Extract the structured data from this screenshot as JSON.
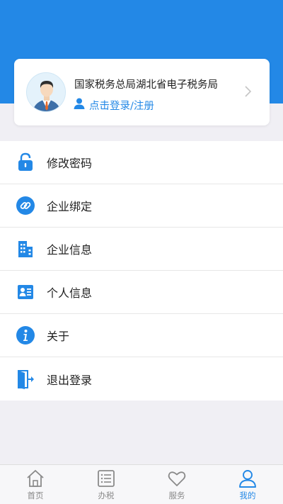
{
  "profile": {
    "org_name": "国家税务总局湖北省电子税务局",
    "login_label": "点击登录/注册"
  },
  "menu": {
    "items": [
      {
        "label": "修改密码",
        "icon": "lock-icon"
      },
      {
        "label": "企业绑定",
        "icon": "link-icon"
      },
      {
        "label": "企业信息",
        "icon": "building-icon"
      },
      {
        "label": "个人信息",
        "icon": "id-card-icon"
      },
      {
        "label": "关于",
        "icon": "info-icon"
      },
      {
        "label": "退出登录",
        "icon": "logout-door-icon"
      }
    ]
  },
  "tabbar": {
    "items": [
      {
        "label": "首页",
        "icon": "home-icon",
        "active": false
      },
      {
        "label": "办税",
        "icon": "list-icon",
        "active": false
      },
      {
        "label": "服务",
        "icon": "heart-icon",
        "active": false
      },
      {
        "label": "我的",
        "icon": "person-icon",
        "active": true
      }
    ]
  },
  "colors": {
    "primary": "#2388e6",
    "background": "#f0eff4"
  }
}
